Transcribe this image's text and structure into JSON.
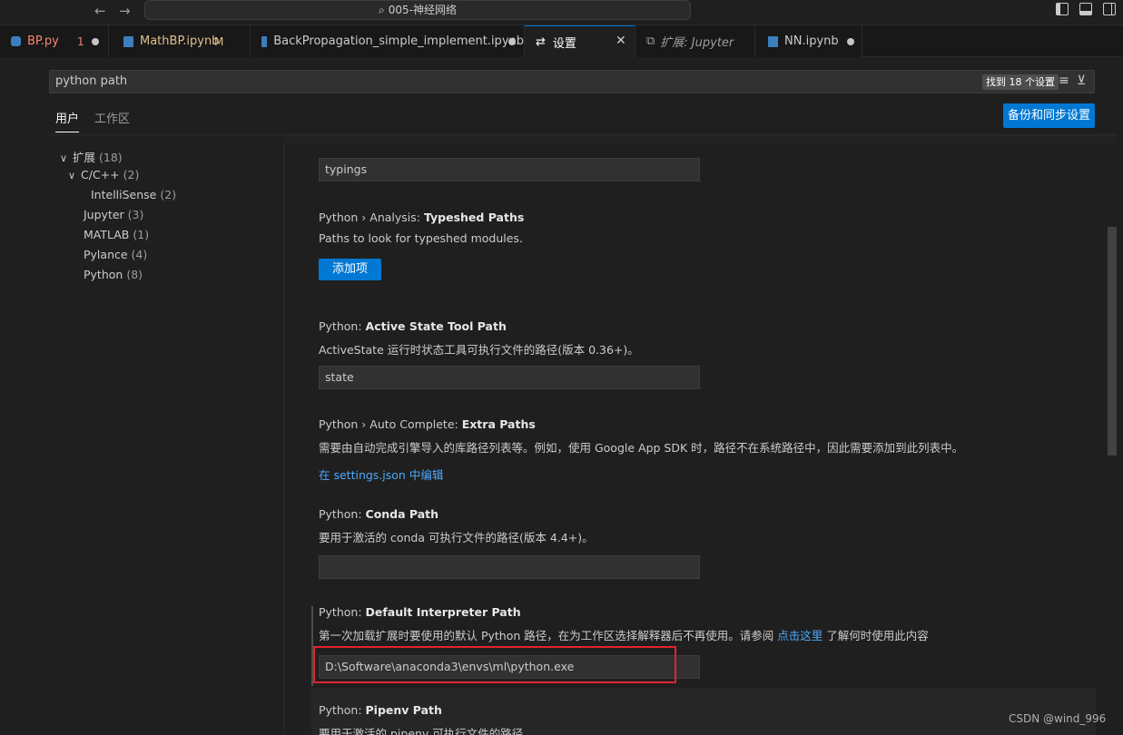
{
  "titlebar": {
    "title": "005-神经网络",
    "back": "←",
    "forward": "→"
  },
  "tabs": [
    {
      "label": "BP.py",
      "badge": "1",
      "color": "#f48771"
    },
    {
      "label": "MathBP.ipynb",
      "badge": "M",
      "color": "#e2c08d"
    },
    {
      "label": "BackPropagation_simple_implement.ipynb",
      "color": "#cccccc"
    },
    {
      "label": "设置",
      "color": "#ffffff"
    },
    {
      "label": "扩展: Jupyter",
      "color": "#9d9d9d"
    },
    {
      "label": "NN.ipynb",
      "color": "#cccccc"
    }
  ],
  "search": {
    "value": "python path",
    "result_count": "找到 18 个设置"
  },
  "scopes": {
    "user": "用户",
    "workspace": "工作区"
  },
  "sync_button": "备份和同步设置",
  "tree": [
    {
      "label": "扩展",
      "count": "(18)",
      "chevron": "∨"
    },
    {
      "label": "C/C++",
      "count": "(2)",
      "chevron": "∨"
    },
    {
      "label": "IntelliSense",
      "count": "(2)"
    },
    {
      "label": "Jupyter",
      "count": "(3)"
    },
    {
      "label": "MATLAB",
      "count": "(1)"
    },
    {
      "label": "Pylance",
      "count": "(4)"
    },
    {
      "label": "Python",
      "count": "(8)"
    }
  ],
  "settings": {
    "typings_value": "typings",
    "typeshed": {
      "category": "Python › Analysis: ",
      "name": "Typeshed Paths",
      "desc": "Paths to look for typeshed modules.",
      "button": "添加项"
    },
    "active_state": {
      "category": "Python: ",
      "name": "Active State Tool Path",
      "desc": "ActiveState 运行时状态工具可执行文件的路径(版本 0.36+)。",
      "value": "state"
    },
    "auto_complete": {
      "category": "Python › Auto Complete: ",
      "name": "Extra Paths",
      "desc": "需要由自动完成引擎导入的库路径列表等。例如，使用 Google App SDK 时，路径不在系统路径中，因此需要添加到此列表中。",
      "link": "在 settings.json 中编辑"
    },
    "conda": {
      "category": "Python: ",
      "name": "Conda Path",
      "desc": "要用于激活的 conda 可执行文件的路径(版本 4.4+)。",
      "value": ""
    },
    "default_interpreter": {
      "category": "Python: ",
      "name": "Default Interpreter Path",
      "desc_before": "第一次加载扩展时要使用的默认 Python 路径，在为工作区选择解释器后不再使用。请参阅 ",
      "desc_link": "点击这里",
      "desc_after": " 了解何时使用此内容",
      "value": "D:\\Software\\anaconda3\\envs\\ml\\python.exe"
    },
    "pipenv": {
      "category": "Python: ",
      "name": "Pipenv Path",
      "desc": "要用于激活的 pipenv 可执行文件的路径。"
    }
  },
  "watermark": "CSDN @wind_996"
}
